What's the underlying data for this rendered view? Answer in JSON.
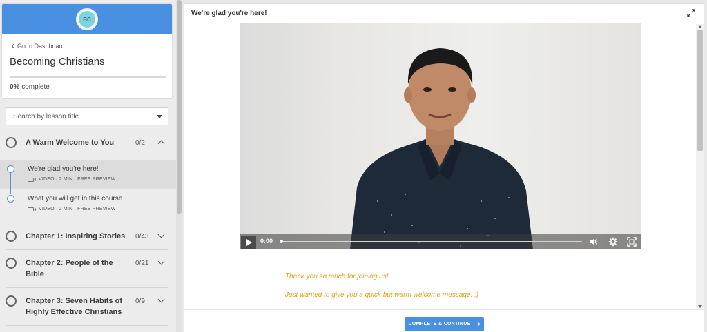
{
  "sidebar": {
    "course_logo_text": "BC",
    "dashboard_link": "Go to Dashboard",
    "course_title": "Becoming Christians",
    "progress_percent": "0%",
    "progress_suffix": "complete",
    "progress_fraction": 0,
    "search_placeholder": "Search by lesson title",
    "sections": [
      {
        "title": "A Warm Welcome to You",
        "count": "0/2",
        "expanded": true,
        "lessons": [
          {
            "title": "We're glad you're here!",
            "meta": "VIDEO · 2 MIN · FREE PREVIEW",
            "active": true
          },
          {
            "title": "What you will get in this course",
            "meta": "VIDEO · 2 MIN · FREE PREVIEW",
            "active": false
          }
        ]
      },
      {
        "title": "Chapter 1: Inspiring Stories",
        "count": "0/43",
        "expanded": false
      },
      {
        "title_line1": "Chapter 2: People of the",
        "title_line2": "Bible",
        "count": "0/21",
        "expanded": false
      },
      {
        "title_line1": "Chapter 3: Seven Habits of",
        "title_line2": "Highly Effective Christians",
        "count": "0/9",
        "expanded": false
      }
    ]
  },
  "main": {
    "lesson_heading": "We're glad you're here!",
    "video": {
      "current_time": "0:00",
      "progress_fraction": 0
    },
    "description": [
      "Thank you so much for joining us!",
      "Just wanted to give you a quick but warm welcome message. :)"
    ],
    "complete_button": "COMPLETE & CONTINUE"
  },
  "colors": {
    "accent": "#4a90e2",
    "description_text": "#e6a01a",
    "sidebar_bg": "#ececec"
  },
  "icons": [
    "chevron-left-icon",
    "caret-down-icon",
    "expand-icon",
    "play-icon",
    "volume-icon",
    "settings-icon",
    "fullscreen-icon",
    "video-camera-icon",
    "arrow-right-icon"
  ]
}
